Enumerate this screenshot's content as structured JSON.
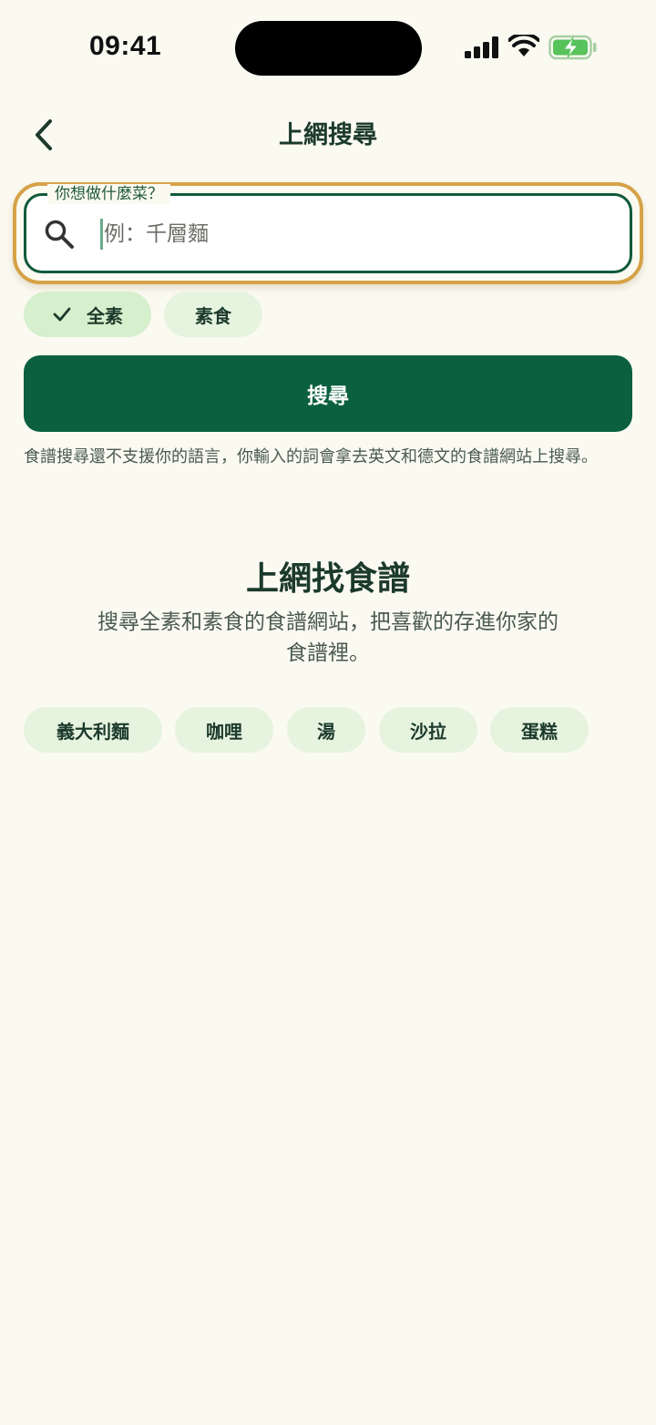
{
  "status_bar": {
    "time": "09:41",
    "signal_icon": "cellular-signal-icon",
    "wifi_icon": "wifi-icon",
    "battery_icon": "battery-charging-icon",
    "battery_color": "#57c35a"
  },
  "nav": {
    "back_icon": "chevron-left-icon",
    "title": "上網搜尋"
  },
  "search": {
    "label": "你想做什麼菜？",
    "placeholder": "例：千層麵",
    "value": "",
    "icon": "search-icon"
  },
  "filters": [
    {
      "label": "全素",
      "selected": true,
      "icon": "checkmark-icon"
    },
    {
      "label": "素食",
      "selected": false
    }
  ],
  "search_button": {
    "label": "搜尋"
  },
  "notice": "食譜搜尋還不支援你的語言，你輸入的詞會拿去英文和德文的食譜網站上搜尋。",
  "section": {
    "heading": "上網找食譜",
    "description": "搜尋全素和素食的食譜網站，把喜歡的存進你家的食譜裡。"
  },
  "suggestions": [
    "義大利麵",
    "咖哩",
    "湯",
    "沙拉",
    "蛋糕"
  ],
  "colors": {
    "background": "#fbfaf1",
    "primary": "#0b6040",
    "chip_selected": "#d6efcd",
    "chip": "#e6f3df",
    "focus_ring": "#d6a247",
    "text": "#1c3a2c"
  }
}
